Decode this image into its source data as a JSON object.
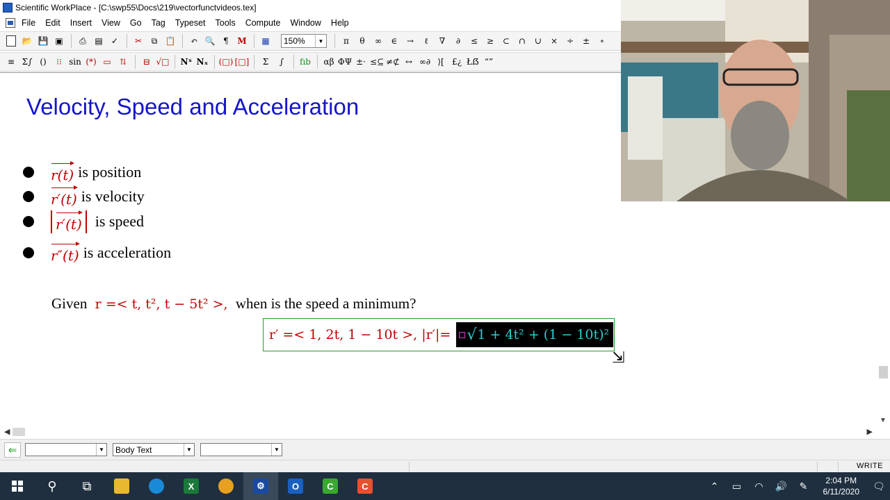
{
  "window": {
    "title": "Scientific WorkPlace - [C:\\swp55\\Docs\\219\\vectorfunctvideos.tex]"
  },
  "menu": {
    "items": [
      "File",
      "Edit",
      "Insert",
      "View",
      "Go",
      "Tag",
      "Typeset",
      "Tools",
      "Compute",
      "Window",
      "Help"
    ]
  },
  "toolbar": {
    "zoom": "150%",
    "math_symbols": [
      "π",
      "θ",
      "∞",
      "∈",
      "→",
      "ℓ",
      "∇",
      "∂",
      "≤",
      "≥",
      "⊂",
      "∩",
      "∪",
      "×",
      "÷",
      "±",
      "∘"
    ]
  },
  "document": {
    "title": "Velocity, Speed and Acceleration",
    "bullets": [
      {
        "math": "r(t)",
        "text": "is position"
      },
      {
        "math": "r′(t)",
        "text": "is velocity"
      },
      {
        "math": "r′(t)",
        "text": "is speed"
      },
      {
        "math": "r″(t)",
        "text": "is acceleration"
      }
    ],
    "given_prefix": "Given",
    "given_expr": "r =< t, t², t − 5t² >,",
    "given_suffix": "when is the speed a minimum?",
    "answer_expr": "r′ =< 1, 2t, 1 − 10t >, |r′|=",
    "answer_selected": "1 + 4t² + (1 − 10t)²"
  },
  "tagbar": {
    "section_tag": "",
    "body_tag": "Body Text",
    "text_tag": ""
  },
  "status": {
    "mode": "WRITE"
  },
  "taskbar": {
    "time": "2:04 PM",
    "date": "6/11/2020"
  },
  "colors": {
    "title_blue": "#1515cc",
    "math_red": "#c00000",
    "box_green": "#2a9a2a",
    "selection_cyan": "#2ad0d0"
  }
}
